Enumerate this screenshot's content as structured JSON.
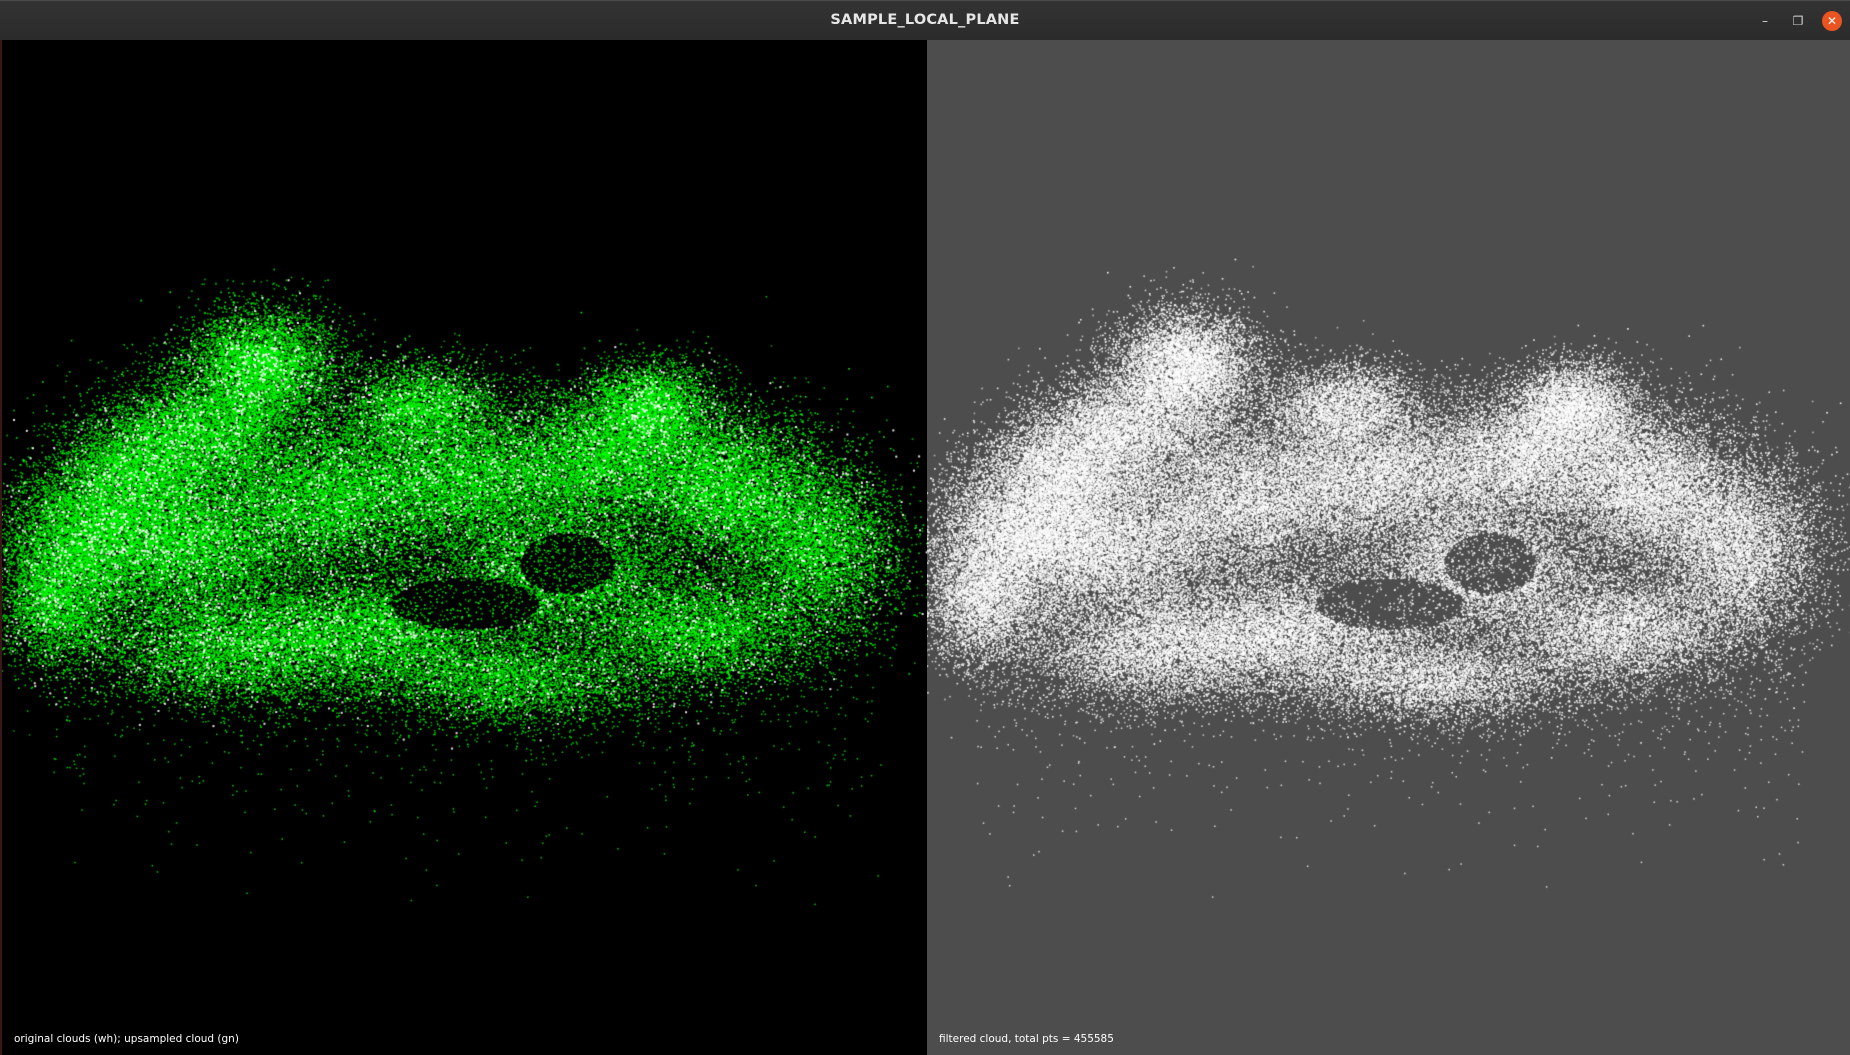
{
  "window": {
    "title": "SAMPLE_LOCAL_PLANE",
    "minimize_label": "–",
    "maximize_label": "❐",
    "close_label": "✕"
  },
  "viewports": {
    "left": {
      "caption": "original clouds (wh); upsampled cloud (gn)",
      "background": "#000000",
      "primary_point_color": "#00ff00",
      "secondary_point_color": "#ffffff"
    },
    "right": {
      "caption": "filtered cloud, total pts = 455585",
      "background": "#4d4d4d",
      "point_color": "#ffffff"
    }
  }
}
